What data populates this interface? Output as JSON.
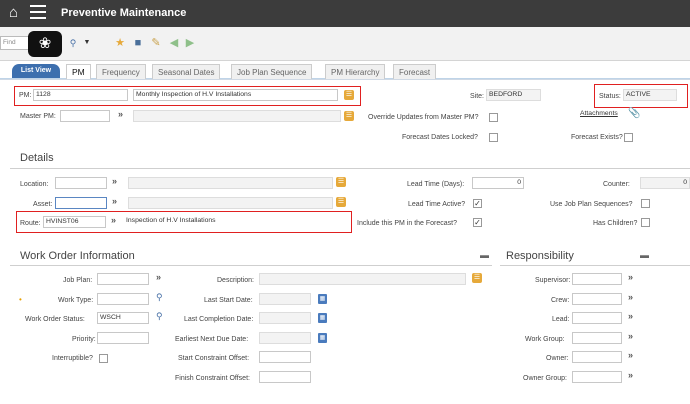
{
  "header": {
    "title": "Preventive Maintenance"
  },
  "toolbar": {
    "find_placeholder": "Find"
  },
  "tabs": [
    {
      "label": "List View"
    },
    {
      "label": "PM"
    },
    {
      "label": "Frequency"
    },
    {
      "label": "Seasonal Dates"
    },
    {
      "label": "Job Plan Sequence"
    },
    {
      "label": "PM Hierarchy"
    },
    {
      "label": "Forecast"
    }
  ],
  "pm": {
    "pm_label": "PM:",
    "pm_value": "1128",
    "description": "Monthly Inspection of H.V Installations",
    "site_label": "Site:",
    "site_value": "BEDFORD",
    "status_label": "Status:",
    "status_value": "ACTIVE",
    "master_pm_label": "Master PM:",
    "override_label": "Override Updates from Master PM?",
    "attachments_label": "Attachments",
    "forecast_locked_label": "Forecast Dates Locked?",
    "forecast_exists_label": "Forecast Exists?"
  },
  "details": {
    "title": "Details",
    "location_label": "Location:",
    "asset_label": "Asset:",
    "route_label": "Route:",
    "route_value": "HVINST06",
    "route_desc": "Inspection of H.V Installations",
    "lead_time_days_label": "Lead Time (Days):",
    "lead_time_days_value": "0",
    "lead_time_active_label": "Lead Time Active?",
    "include_forecast_label": "Include this PM in the Forecast?",
    "counter_label": "Counter:",
    "counter_value": "0",
    "use_job_plan_label": "Use Job Plan Sequences?",
    "has_children_label": "Has Children?"
  },
  "work_order": {
    "title": "Work Order Information",
    "job_plan_label": "Job Plan:",
    "description_label": "Description:",
    "work_type_label": "Work Type:",
    "last_start_label": "Last Start Date:",
    "wo_status_label": "Work Order Status:",
    "wo_status_value": "WSCH",
    "last_completion_label": "Last Completion Date:",
    "priority_label": "Priority:",
    "earliest_next_label": "Earliest Next Due Date:",
    "interruptible_label": "Interruptible?",
    "start_constraint_label": "Start Constraint Offset:",
    "finish_constraint_label": "Finish Constraint Offset:"
  },
  "responsibility": {
    "title": "Responsibility",
    "supervisor_label": "Supervisor:",
    "crew_label": "Crew:",
    "lead_label": "Lead:",
    "work_group_label": "Work Group:",
    "owner_label": "Owner:",
    "owner_group_label": "Owner Group:"
  },
  "icons": [
    "home-icon",
    "menu-icon",
    "brain-logo-icon",
    "search-icon",
    "new-record-icon",
    "save-icon",
    "edit-icon",
    "prev-icon",
    "next-icon",
    "lookup-icon",
    "calendar-icon",
    "attachment-icon",
    "section-menu-icon"
  ],
  "colors": {
    "accent": "#3d6fae",
    "highlight": "#e02020",
    "topbar": "#3c3c3c"
  }
}
